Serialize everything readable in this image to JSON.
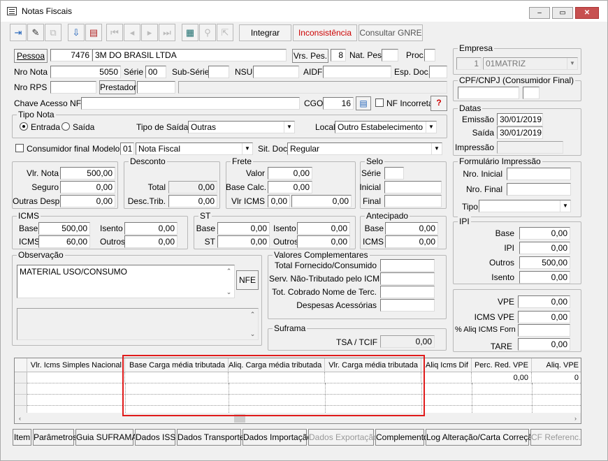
{
  "window": {
    "title": "Notas Fiscais",
    "minimize": "‒",
    "maximize": "▭",
    "close": "✕"
  },
  "toolbar": {
    "integrar": "Integrar",
    "inconsistencia": "Inconsistência",
    "consultar_gnre": "Consultar GNRE",
    "inconsistencia_color": "#cc0000"
  },
  "header": {
    "pessoa_label": "Pessoa",
    "pessoa_code": "7476",
    "pessoa_name": "3M DO BRASIL LTDA",
    "vrs_pes_label": "Vrs. Pes.",
    "vrs_pes_value": "8",
    "nat_pes_label": "Nat. Pes.",
    "nat_pes_value": "",
    "proc_label": "Proc.",
    "nro_nota_label": "Nro Nota",
    "nro_nota_value": "5050",
    "serie_label": "Série",
    "serie_value": "00",
    "sub_serie_label": "Sub-Série",
    "nsu_label": "NSU",
    "aidf_label": "AIDF",
    "esp_doc_label": "Esp. Doc.",
    "nro_rps_label": "Nro RPS",
    "prestador_label": "Prestador",
    "chave_label": "Chave Acesso NFe",
    "cgo_label": "CGO",
    "cgo_value": "16",
    "nf_incorreta_label": "NF Incorreta",
    "help_icon": "?"
  },
  "tipo_nota": {
    "title": "Tipo Nota",
    "entrada": "Entrada",
    "saida": "Saída",
    "tipo_saida_label": "Tipo de Saída",
    "tipo_saida_value": "Outras",
    "local_label": "Local",
    "local_value": "Outro Estabelecimento"
  },
  "consumidor": {
    "consumidor_label": "Consumidor final",
    "modelo_label": "Modelo",
    "modelo_code": "01",
    "modelo_value": "Nota Fiscal",
    "sit_doc_label": "Sit. Doc.",
    "sit_doc_value": "Regular"
  },
  "valores": {
    "vlr_nota_label": "Vlr. Nota",
    "vlr_nota": "500,00",
    "seguro_label": "Seguro",
    "seguro": "0,00",
    "outras_label": "Outras Desp",
    "outras": "0,00"
  },
  "desconto": {
    "title": "Desconto",
    "total_label": "Total",
    "total": "0,00",
    "desc_trib_label": "Desc.Trib.",
    "desc_trib": "0,00"
  },
  "frete": {
    "title": "Frete",
    "valor_label": "Valor",
    "valor": "0,00",
    "base_label": "Base Calc.",
    "base": "0,00",
    "vlr_icms_label": "Vlr ICMS",
    "vlr_icms_a": "0,00",
    "vlr_icms_b": "0,00"
  },
  "selo": {
    "title": "Selo",
    "serie_label": "Série",
    "inicial_label": "Inicial",
    "final_label": "Final"
  },
  "icms": {
    "title": "ICMS",
    "base_label": "Base",
    "base": "500,00",
    "icms_label": "ICMS",
    "icms": "60,00",
    "isento_label": "Isento",
    "isento": "0,00",
    "outros_label": "Outros",
    "outros": "0,00"
  },
  "st": {
    "title": "ST",
    "base_label": "Base",
    "base": "0,00",
    "st_label": "ST",
    "st": "0,00",
    "isento_label": "Isento",
    "isento": "0,00",
    "outros_label": "Outros",
    "outros": "0,00"
  },
  "antecipado": {
    "title": "Antecipado",
    "base_label": "Base",
    "base": "0,00",
    "icms_label": "ICMS",
    "icms": "0,00"
  },
  "observacao": {
    "title": "Observação",
    "text": "MATERIAL USO/CONSUMO",
    "nfe_button": "NFE"
  },
  "valores_complementares": {
    "title": "Valores Complementares",
    "total_label": "Total Fornecido/Consumido",
    "serv_label": "Serv. Não-Tributado pelo ICMS",
    "tot_label": "Tot. Cobrado Nome de Terc.",
    "desp_label": "Despesas Acessórias"
  },
  "suframa": {
    "title": "Suframa",
    "tsa_label": "TSA / TCIF",
    "tsa": "0,00"
  },
  "empresa": {
    "title": "Empresa",
    "code": "1",
    "name": "01MATRIZ"
  },
  "cpf": {
    "title": "CPF/CNPJ (Consumidor Final)"
  },
  "datas": {
    "title": "Datas",
    "emissao_label": "Emissão",
    "emissao": "30/01/2019",
    "saida_label": "Saída",
    "saida": "30/01/2019",
    "impressao_label": "Impressão"
  },
  "formulario": {
    "title": "Formulário Impressão",
    "nro_inicial_label": "Nro. Inicial",
    "nro_final_label": "Nro. Final",
    "tipo_label": "Tipo"
  },
  "ipi": {
    "title": "IPI",
    "base_label": "Base",
    "base": "0,00",
    "ipi_label": "IPI",
    "ipi": "0,00",
    "outros_label": "Outros",
    "outros": "500,00",
    "isento_label": "Isento",
    "isento": "0,00"
  },
  "vpe": {
    "vpe_label": "VPE",
    "vpe": "0,00",
    "icms_vpe_label": "ICMS VPE",
    "icms_vpe": "0,00",
    "aliq_label": "% Aliq ICMS Forn",
    "aliq": "",
    "tare_label": "TARE",
    "tare": "0,00"
  },
  "grid": {
    "columns": [
      "Vlr. Icms Simples Nacional",
      "Base Carga média tributada",
      "Aliq. Carga média tributada",
      "Vlr. Carga média tributada",
      "Aliq Icms Dif",
      "Perc. Red. VPE",
      "Aliq. VPE"
    ],
    "row1": [
      "",
      "",
      "",
      "",
      "",
      "0,00",
      "0"
    ]
  },
  "tabs": [
    "Item",
    "Parâmetros",
    "Guia SUFRAMA",
    "Dados ISS",
    "Dados Transporte",
    "Dados Importação",
    "Dados Exportação",
    "Complemento",
    "Log Alteração/Carta Correção",
    "CF Referenc."
  ]
}
